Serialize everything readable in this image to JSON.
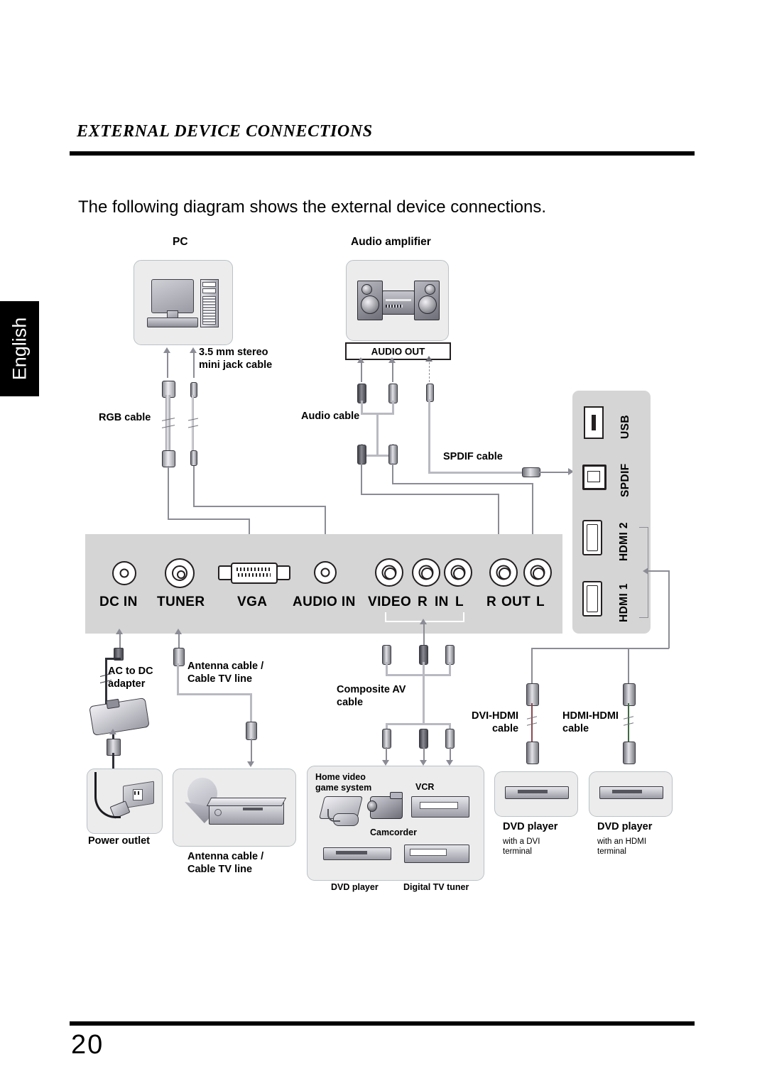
{
  "header": {
    "section_title": "EXTERNAL DEVICE CONNECTIONS",
    "intro": "The following diagram shows the external device connections."
  },
  "side_tab": {
    "language": "English"
  },
  "footer": {
    "page_number": "20"
  },
  "diagram": {
    "sources": {
      "pc": "PC",
      "audio_amplifier": "Audio amplifier",
      "audio_out_bar": "AUDIO OUT"
    },
    "cables": {
      "rgb": "RGB cable",
      "mini_jack": "3.5 mm stereo\nmini jack cable",
      "audio": "Audio cable",
      "spdif": "SPDIF cable",
      "ac_adapter": "AC to DC\nadapter",
      "antenna_top": "Antenna cable /\nCable TV line",
      "composite_av": "Composite AV\ncable",
      "dvi_hdmi": "DVI-HDMI\ncable",
      "hdmi_hdmi": "HDMI-HDMI\ncable"
    },
    "panel_ports": {
      "dc_in": "DC IN",
      "tuner": "TUNER",
      "vga": "VGA",
      "audio_in": "AUDIO IN",
      "video": "VIDEO",
      "in_r": "R",
      "in_label": "IN",
      "in_l": "L",
      "out_r": "R",
      "out_label": "OUT",
      "out_l": "L"
    },
    "side_ports": {
      "usb": "USB",
      "spdif": "SPDIF",
      "hdmi2": "HDMI 2",
      "hdmi1": "HDMI 1"
    },
    "devices": {
      "power_outlet": "Power outlet",
      "antenna_box": "Antenna cable /\nCable TV line",
      "home_video_game_system": "Home video\ngame system",
      "camcorder": "Camcorder",
      "vcr": "VCR",
      "dvd_player_center": "DVD player",
      "digital_tv_tuner": "Digital TV tuner",
      "dvd_player_dvi": "DVD player",
      "dvd_player_dvi_note": "with a DVI\nterminal",
      "dvd_player_hdmi": "DVD player",
      "dvd_player_hdmi_note": "with an HDMI\nterminal"
    }
  }
}
